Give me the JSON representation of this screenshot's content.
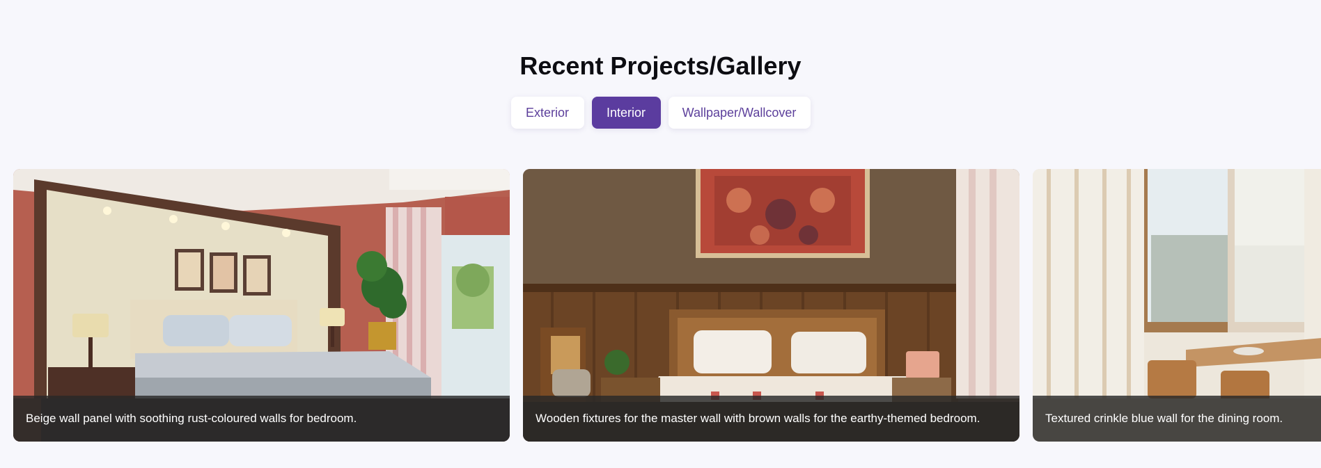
{
  "gallery": {
    "title": "Recent Projects/Gallery",
    "tabs": [
      {
        "label": "Exterior",
        "active": false
      },
      {
        "label": "Interior",
        "active": true
      },
      {
        "label": "Wallpaper/Wallcover",
        "active": false
      }
    ],
    "items": [
      {
        "caption": "Beige wall panel with soothing rust-coloured walls for bedroom."
      },
      {
        "caption": "Wooden fixtures for the master wall with brown walls for the earthy-themed bedroom."
      },
      {
        "caption": "Textured crinkle blue wall for the dining room."
      }
    ]
  },
  "colors": {
    "page_background": "#f7f7fc",
    "accent": "#5b3c9f",
    "tab_text": "#5c3f9b",
    "caption_overlay": "#282828"
  }
}
